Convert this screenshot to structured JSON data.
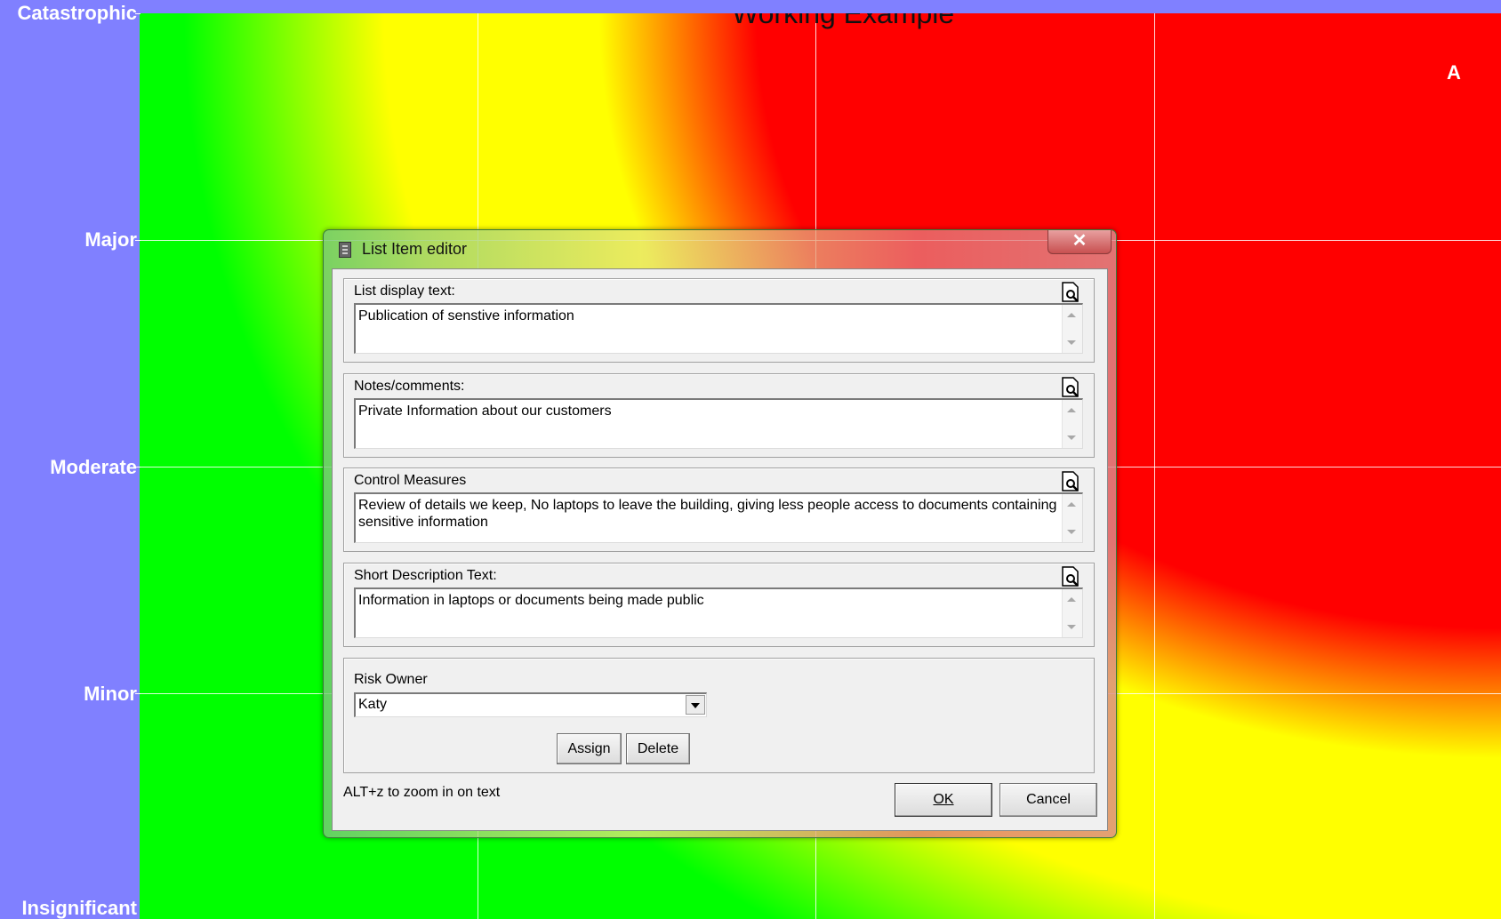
{
  "chart": {
    "title": "Working Example",
    "y_levels": [
      "Catastrophic",
      "Major",
      "Moderate",
      "Minor",
      "Insignificant"
    ],
    "marker_label": "A",
    "colors": {
      "low": "#00ff00",
      "medium": "#ffff00",
      "high": "#ff0000",
      "background": "#8080ff"
    }
  },
  "dialog": {
    "title": "List Item editor",
    "close_label": "✕",
    "fields": [
      {
        "label": "List display text:",
        "value": "Publication of senstive information"
      },
      {
        "label": "Notes/comments:",
        "value": "Private Information about our customers"
      },
      {
        "label": "Control Measures",
        "value": "Review of details we keep, No laptops to leave the building, giving less people access to documents containing sensitive information"
      },
      {
        "label": "Short Description Text:",
        "value": "Information in laptops or documents being made public"
      }
    ],
    "risk_owner": {
      "label": "Risk Owner",
      "value": "Katy"
    },
    "assign_label": "Assign",
    "delete_label": "Delete",
    "hint": "ALT+z to zoom in on text",
    "ok_label": "OK",
    "cancel_label": "Cancel",
    "zoom_icon": "zoom-document-icon"
  }
}
